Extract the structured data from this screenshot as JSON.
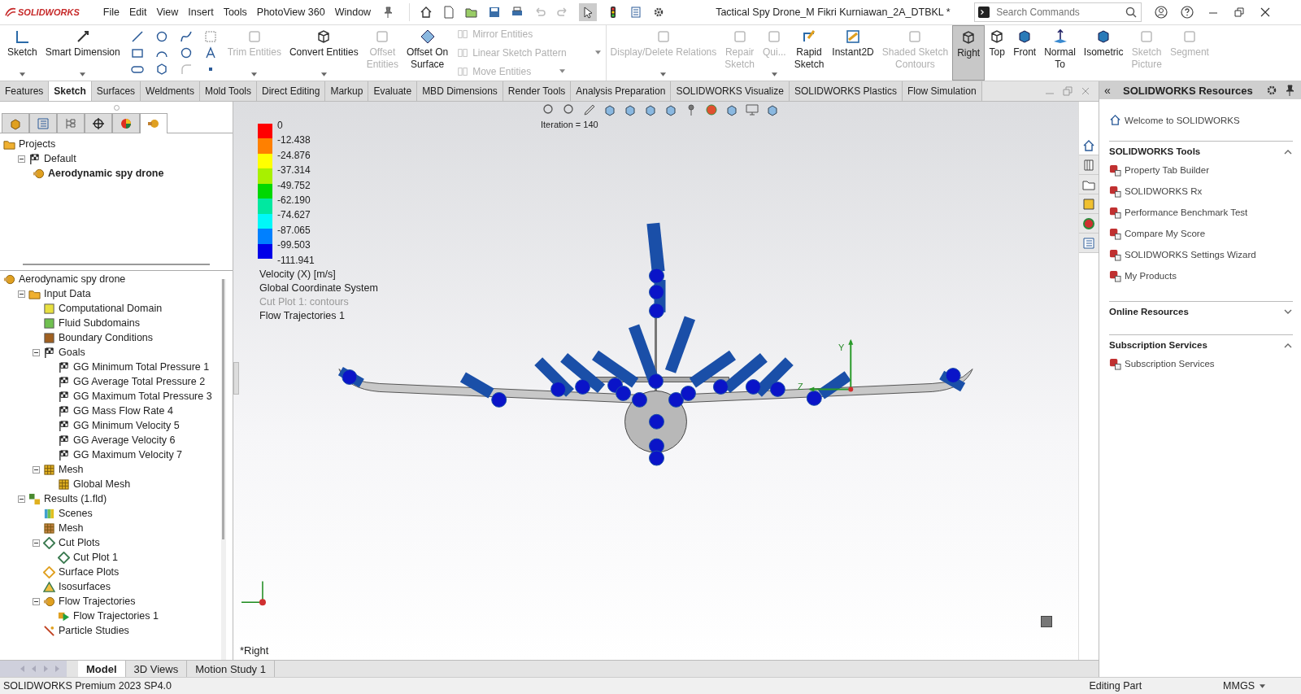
{
  "app": {
    "logo": "SOLIDWORKS",
    "menus": [
      "File",
      "Edit",
      "View",
      "Insert",
      "Tools",
      "PhotoView 360",
      "Window"
    ],
    "document_title": "Tactical Spy Drone_M Fikri Kurniawan_2A_DTBKL *",
    "search": {
      "placeholder": "Search Commands"
    }
  },
  "ribbon": [
    {
      "kind": "button",
      "label": "Sketch",
      "disabled": false,
      "selected": false,
      "dropdown": true
    },
    {
      "kind": "button",
      "label": "Smart Dimension",
      "disabled": false,
      "selected": false,
      "dropdown": true
    },
    {
      "kind": "tool-grid"
    },
    {
      "kind": "button",
      "label": "Trim Entities",
      "disabled": true,
      "selected": false,
      "dropdown": true
    },
    {
      "kind": "button",
      "label": "Convert Entities",
      "disabled": false,
      "selected": false,
      "dropdown": true
    },
    {
      "kind": "button",
      "label": "Offset\nEntities",
      "disabled": true,
      "selected": false,
      "dropdown": false
    },
    {
      "kind": "button",
      "label": "Offset On\nSurface",
      "disabled": false,
      "selected": false,
      "dropdown": false
    },
    {
      "kind": "stack",
      "entries": [
        {
          "label": "Mirror Entities",
          "disabled": true,
          "dropdown": false
        },
        {
          "label": "Linear Sketch Pattern",
          "disabled": true,
          "dropdown": true
        },
        {
          "label": "Move Entities",
          "disabled": true,
          "dropdown": true
        }
      ]
    },
    {
      "kind": "button",
      "label": "Display/Delete Relations",
      "disabled": true,
      "selected": false,
      "dropdown": true
    },
    {
      "kind": "button",
      "label": "Repair\nSketch",
      "disabled": true,
      "selected": false,
      "dropdown": false
    },
    {
      "kind": "button",
      "label": "Qui...",
      "disabled": true,
      "selected": false,
      "dropdown": true
    },
    {
      "kind": "button",
      "label": "Rapid\nSketch",
      "disabled": false,
      "selected": false,
      "dropdown": false
    },
    {
      "kind": "button",
      "label": "Instant2D",
      "disabled": false,
      "selected": false,
      "dropdown": false
    },
    {
      "kind": "button",
      "label": "Shaded Sketch\nContours",
      "disabled": true,
      "selected": false,
      "dropdown": false
    },
    {
      "kind": "button",
      "label": "Right",
      "disabled": false,
      "selected": true,
      "dropdown": false
    },
    {
      "kind": "button",
      "label": "Top",
      "disabled": false,
      "selected": false,
      "dropdown": false
    },
    {
      "kind": "button",
      "label": "Front",
      "disabled": false,
      "selected": false,
      "dropdown": false
    },
    {
      "kind": "button",
      "label": "Normal\nTo",
      "disabled": false,
      "selected": false,
      "dropdown": false
    },
    {
      "kind": "button",
      "label": "Isometric",
      "disabled": false,
      "selected": false,
      "dropdown": false
    },
    {
      "kind": "button",
      "label": "Sketch\nPicture",
      "disabled": true,
      "selected": false,
      "dropdown": false
    },
    {
      "kind": "button",
      "label": "Segment",
      "disabled": true,
      "selected": false,
      "dropdown": false
    }
  ],
  "tabs": [
    {
      "label": "Features",
      "selected": false
    },
    {
      "label": "Sketch",
      "selected": true
    },
    {
      "label": "Surfaces",
      "selected": false
    },
    {
      "label": "Weldments",
      "selected": false
    },
    {
      "label": "Mold Tools",
      "selected": false
    },
    {
      "label": "Direct Editing",
      "selected": false
    },
    {
      "label": "Markup",
      "selected": false
    },
    {
      "label": "Evaluate",
      "selected": false
    },
    {
      "label": "MBD Dimensions",
      "selected": false
    },
    {
      "label": "Render Tools",
      "selected": false
    },
    {
      "label": "Analysis Preparation",
      "selected": false
    },
    {
      "label": "SOLIDWORKS Visualize",
      "selected": false
    },
    {
      "label": "SOLIDWORKS Plastics",
      "selected": false
    },
    {
      "label": "Flow Simulation",
      "selected": false
    }
  ],
  "panel_tabs": [
    {
      "selected": false
    },
    {
      "selected": false
    },
    {
      "selected": false
    },
    {
      "selected": false
    },
    {
      "selected": false
    },
    {
      "selected": true
    }
  ],
  "projects_tree": [
    {
      "label": "Projects",
      "kind": "folder",
      "active": false,
      "children": [
        {
          "label": "Default",
          "kind": "flag",
          "active": false,
          "expanded": true,
          "children": [
            {
              "label": "Aerodynamic spy drone",
              "kind": "project",
              "active": true
            }
          ]
        }
      ]
    }
  ],
  "model_tree": [
    {
      "label": "Aerodynamic spy drone",
      "kind": "project",
      "children": [
        {
          "label": "Input Data",
          "kind": "folder",
          "expanded": true,
          "children": [
            {
              "label": "Computational Domain",
              "kind": "domain"
            },
            {
              "label": "Fluid Subdomains",
              "kind": "subdomain"
            },
            {
              "label": "Boundary Conditions",
              "kind": "boundary"
            },
            {
              "label": "Goals",
              "kind": "flag",
              "expanded": true,
              "children": [
                {
                  "label": "GG Minimum Total Pressure 1",
                  "kind": "flag"
                },
                {
                  "label": "GG Average Total Pressure 2",
                  "kind": "flag"
                },
                {
                  "label": "GG Maximum Total Pressure 3",
                  "kind": "flag"
                },
                {
                  "label": "GG Mass Flow Rate 4",
                  "kind": "flag"
                },
                {
                  "label": "GG Minimum Velocity 5",
                  "kind": "flag"
                },
                {
                  "label": "GG Average Velocity 6",
                  "kind": "flag"
                },
                {
                  "label": "GG Maximum Velocity 7",
                  "kind": "flag"
                }
              ]
            },
            {
              "label": "Mesh",
              "kind": "mesh",
              "expanded": true,
              "children": [
                {
                  "label": "Global Mesh",
                  "kind": "mesh"
                }
              ]
            }
          ]
        },
        {
          "label": "Results (1.fld)",
          "kind": "results",
          "expanded": true,
          "children": [
            {
              "label": "Scenes",
              "kind": "scenes"
            },
            {
              "label": "Mesh",
              "kind": "grid"
            },
            {
              "label": "Cut Plots",
              "kind": "cut",
              "expanded": true,
              "children": [
                {
                  "label": "Cut Plot 1",
                  "kind": "cut"
                }
              ]
            },
            {
              "label": "Surface Plots",
              "kind": "surface"
            },
            {
              "label": "Isosurfaces",
              "kind": "iso"
            },
            {
              "label": "Flow Trajectories",
              "kind": "project",
              "expanded": true,
              "children": [
                {
                  "label": "Flow Trajectories 1",
                  "kind": "play"
                }
              ]
            },
            {
              "label": "Particle Studies",
              "kind": "particle"
            }
          ]
        }
      ]
    }
  ],
  "viewport": {
    "iteration": "Iteration = 140",
    "legend": {
      "bands": [
        {
          "color": "#ff0000"
        },
        {
          "color": "#ff8000"
        },
        {
          "color": "#ffff00"
        },
        {
          "color": "#a8f000"
        },
        {
          "color": "#00d800"
        },
        {
          "color": "#00e8a0"
        },
        {
          "color": "#00f8f8"
        },
        {
          "color": "#0080ff"
        },
        {
          "color": "#0000e8"
        }
      ],
      "labels": [
        "0",
        "-12.438",
        "-24.876",
        "-37.314",
        "-49.752",
        "-62.190",
        "-74.627",
        "-87.065",
        "-99.503",
        "-111.941"
      ]
    },
    "captions": [
      {
        "text": "Velocity (X) [m/s]",
        "dimmed": false
      },
      {
        "text": "Global Coordinate System",
        "dimmed": false
      },
      {
        "text": "Cut Plot 1: contours",
        "dimmed": true
      },
      {
        "text": "Flow Trajectories 1",
        "dimmed": false
      }
    ],
    "triad_labels": [
      "Y",
      "Z"
    ],
    "view_name": "*Right"
  },
  "side_tabs": [
    {
      "selected": true
    },
    {
      "selected": false
    },
    {
      "selected": false
    },
    {
      "selected": false
    },
    {
      "selected": false
    },
    {
      "selected": false
    }
  ],
  "resources": {
    "collapse": "«",
    "title": "SOLIDWORKS Resources",
    "welcome": "Welcome to SOLIDWORKS",
    "sections": [
      {
        "title": "SOLIDWORKS Tools",
        "expanded": true,
        "items": [
          "Property Tab Builder",
          "SOLIDWORKS Rx",
          "Performance Benchmark Test",
          "Compare My Score",
          "SOLIDWORKS Settings Wizard",
          "My Products"
        ]
      },
      {
        "title": "Online Resources",
        "expanded": false
      },
      {
        "title": "Subscription Services",
        "expanded": true,
        "items": [
          "Subscription Services"
        ]
      }
    ]
  },
  "bottom_tabs": [
    {
      "label": "Model",
      "selected": true
    },
    {
      "label": "3D Views",
      "selected": false
    },
    {
      "label": "Motion Study 1",
      "selected": false
    }
  ],
  "status_bar": {
    "product": "SOLIDWORKS Premium 2023 SP4.0",
    "mode": "Editing Part",
    "units": "MMGS"
  }
}
